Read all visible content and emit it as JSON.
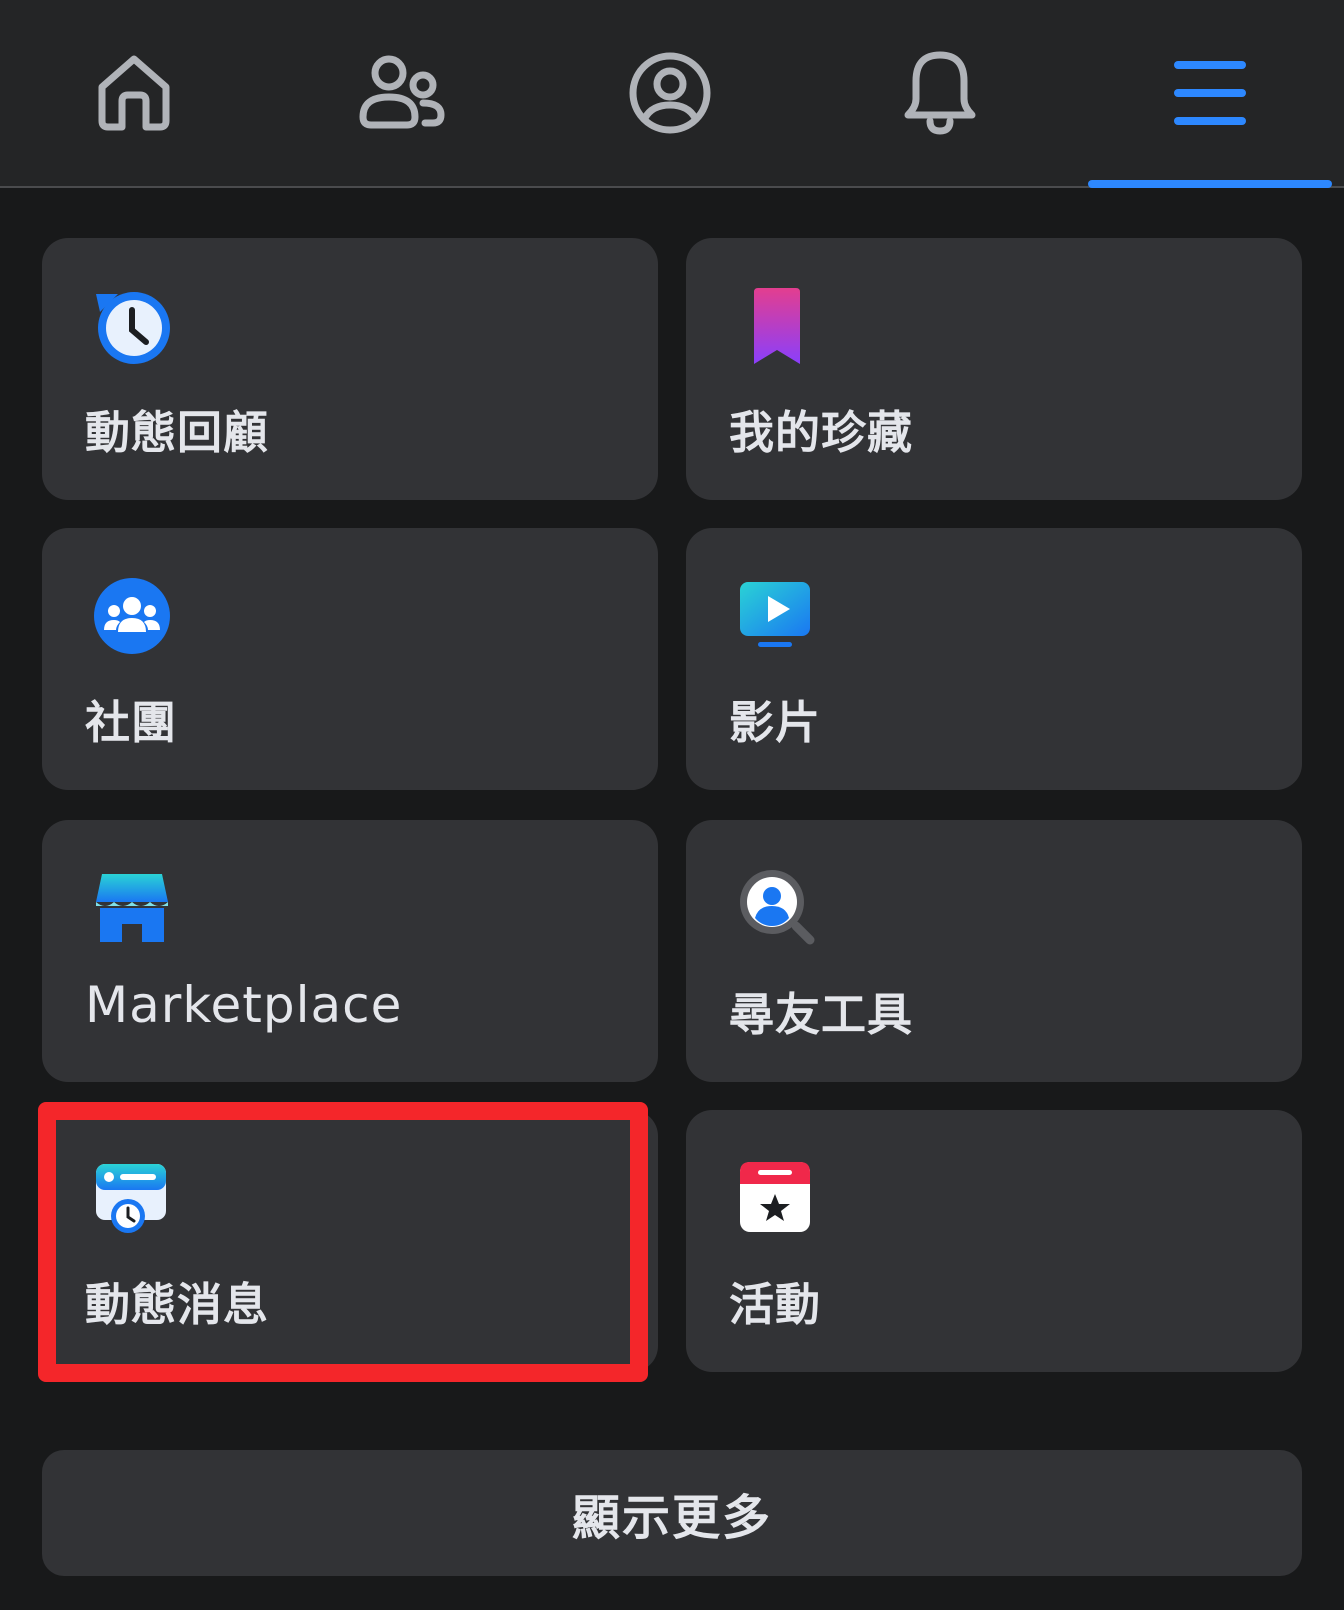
{
  "nav": {
    "tabs": [
      {
        "id": "home",
        "icon": "home-icon",
        "active": false
      },
      {
        "id": "friends",
        "icon": "friends-icon",
        "active": false
      },
      {
        "id": "profile",
        "icon": "profile-icon",
        "active": false
      },
      {
        "id": "notifications",
        "icon": "bell-icon",
        "active": false
      },
      {
        "id": "menu",
        "icon": "hamburger-menu-icon",
        "active": true
      }
    ],
    "active_color": "#2d88ff",
    "inactive_color": "#b0b3b8"
  },
  "shortcuts": [
    {
      "label": "動態回顧",
      "icon": "memories-clock-icon"
    },
    {
      "label": "我的珍藏",
      "icon": "saved-bookmark-icon"
    },
    {
      "label": "社團",
      "icon": "groups-icon"
    },
    {
      "label": "影片",
      "icon": "video-play-icon"
    },
    {
      "label": "Marketplace",
      "icon": "marketplace-store-icon"
    },
    {
      "label": "尋友工具",
      "icon": "find-friends-search-icon"
    },
    {
      "label": "動態消息",
      "icon": "feeds-clock-card-icon",
      "highlighted": true
    },
    {
      "label": "活動",
      "icon": "events-calendar-star-icon"
    }
  ],
  "show_more": {
    "label": "顯示更多"
  },
  "highlight_color": "#f4262a"
}
